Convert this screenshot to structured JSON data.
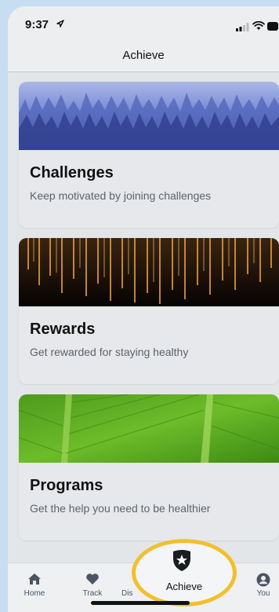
{
  "status_bar": {
    "time": "9:37",
    "icons": [
      "location-arrow-icon",
      "signal-icon",
      "wifi-icon",
      "battery-icon"
    ]
  },
  "header": {
    "title": "Achieve"
  },
  "cards": [
    {
      "title": "Challenges",
      "subtitle": "Keep motivated by joining challenges",
      "image": "blue-forest-image"
    },
    {
      "title": "Rewards",
      "subtitle": "Get rewarded for staying healthy",
      "image": "golden-light-streaks-image"
    },
    {
      "title": "Programs",
      "subtitle": "Get the help you need to be healthier",
      "image": "green-leaf-image"
    }
  ],
  "tab_bar": {
    "tabs": [
      {
        "label": "Home",
        "icon": "home-icon"
      },
      {
        "label": "Track",
        "icon": "heart-icon"
      },
      {
        "label": "Dis",
        "icon": "discover-icon"
      },
      {
        "label": "Achieve",
        "icon": "shield-star-icon",
        "selected": true
      },
      {
        "label": "You",
        "icon": "user-icon"
      }
    ]
  },
  "colors": {
    "highlight_ring": "#f2c02d",
    "page_background": "#c6ddf2",
    "card_background": "#e6e8eb",
    "selected_accent": "#2bb673"
  }
}
